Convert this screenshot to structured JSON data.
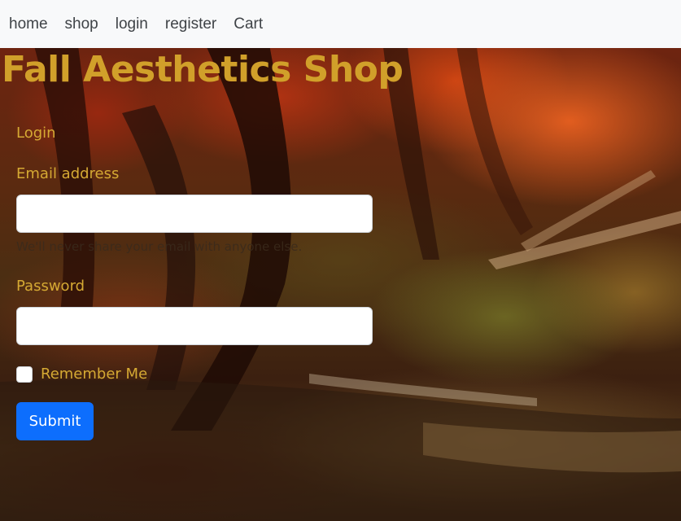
{
  "nav": {
    "items": [
      {
        "label": "home"
      },
      {
        "label": "shop"
      },
      {
        "label": "login"
      },
      {
        "label": "register"
      },
      {
        "label": "Cart"
      }
    ]
  },
  "hero": {
    "title": "Fall Aesthetics Shop"
  },
  "form": {
    "heading": "Login",
    "email_label": "Email address",
    "email_value": "",
    "email_help": "We'll never share your email with anyone else.",
    "password_label": "Password",
    "password_value": "",
    "remember_label": "Remember Me",
    "remember_checked": false,
    "submit_label": "Submit"
  },
  "colors": {
    "title": "#d1a02a",
    "label": "#d5a933",
    "button": "#0d6efd",
    "navbar_bg": "#f8f9fa"
  }
}
